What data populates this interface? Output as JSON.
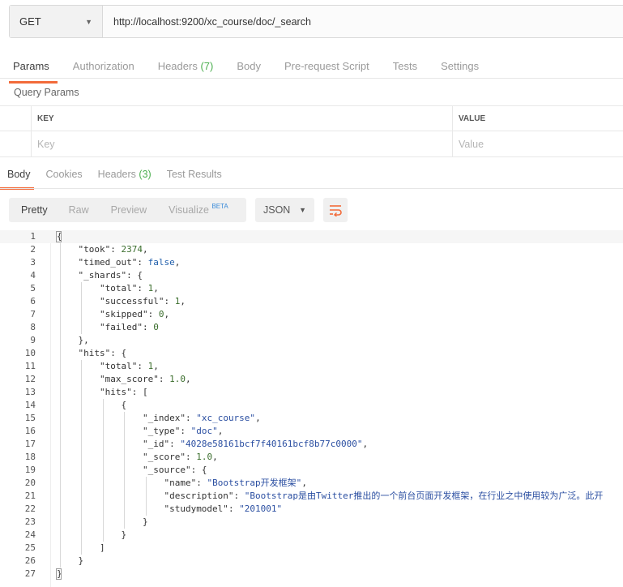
{
  "request": {
    "method": "GET",
    "url": "http://localhost:9200/xc_course/doc/_search"
  },
  "request_tabs": [
    {
      "label": "Params",
      "active": true
    },
    {
      "label": "Authorization"
    },
    {
      "label": "Headers",
      "count": "(7)"
    },
    {
      "label": "Body"
    },
    {
      "label": "Pre-request Script"
    },
    {
      "label": "Tests"
    },
    {
      "label": "Settings"
    }
  ],
  "query_params": {
    "title": "Query Params",
    "key_header": "KEY",
    "value_header": "VALUE",
    "key_placeholder": "Key",
    "value_placeholder": "Value"
  },
  "response_tabs": [
    {
      "label": "Body",
      "active": true
    },
    {
      "label": "Cookies"
    },
    {
      "label": "Headers",
      "count": "(3)"
    },
    {
      "label": "Test Results"
    }
  ],
  "view_modes": {
    "pretty": "Pretty",
    "raw": "Raw",
    "preview": "Preview",
    "visualize": "Visualize",
    "beta": "BETA"
  },
  "format": "JSON",
  "colors": {
    "accent": "#f26b3a",
    "count": "#4caf50",
    "string": "#2a4ea1",
    "number": "#3b6e2d",
    "bool": "#1f5eab"
  },
  "code_lines": [
    [
      [
        "p",
        "{"
      ]
    ],
    [
      [
        "p",
        "    "
      ],
      [
        "k",
        "\"took\""
      ],
      [
        "p",
        ": "
      ],
      [
        "n",
        "2374"
      ],
      [
        "p",
        ","
      ]
    ],
    [
      [
        "p",
        "    "
      ],
      [
        "k",
        "\"timed_out\""
      ],
      [
        "p",
        ": "
      ],
      [
        "b",
        "false"
      ],
      [
        "p",
        ","
      ]
    ],
    [
      [
        "p",
        "    "
      ],
      [
        "k",
        "\"_shards\""
      ],
      [
        "p",
        ": {"
      ]
    ],
    [
      [
        "p",
        "        "
      ],
      [
        "k",
        "\"total\""
      ],
      [
        "p",
        ": "
      ],
      [
        "n",
        "1"
      ],
      [
        "p",
        ","
      ]
    ],
    [
      [
        "p",
        "        "
      ],
      [
        "k",
        "\"successful\""
      ],
      [
        "p",
        ": "
      ],
      [
        "n",
        "1"
      ],
      [
        "p",
        ","
      ]
    ],
    [
      [
        "p",
        "        "
      ],
      [
        "k",
        "\"skipped\""
      ],
      [
        "p",
        ": "
      ],
      [
        "n",
        "0"
      ],
      [
        "p",
        ","
      ]
    ],
    [
      [
        "p",
        "        "
      ],
      [
        "k",
        "\"failed\""
      ],
      [
        "p",
        ": "
      ],
      [
        "n",
        "0"
      ]
    ],
    [
      [
        "p",
        "    },"
      ]
    ],
    [
      [
        "p",
        "    "
      ],
      [
        "k",
        "\"hits\""
      ],
      [
        "p",
        ": {"
      ]
    ],
    [
      [
        "p",
        "        "
      ],
      [
        "k",
        "\"total\""
      ],
      [
        "p",
        ": "
      ],
      [
        "n",
        "1"
      ],
      [
        "p",
        ","
      ]
    ],
    [
      [
        "p",
        "        "
      ],
      [
        "k",
        "\"max_score\""
      ],
      [
        "p",
        ": "
      ],
      [
        "n",
        "1.0"
      ],
      [
        "p",
        ","
      ]
    ],
    [
      [
        "p",
        "        "
      ],
      [
        "k",
        "\"hits\""
      ],
      [
        "p",
        ": ["
      ]
    ],
    [
      [
        "p",
        "            {"
      ]
    ],
    [
      [
        "p",
        "                "
      ],
      [
        "k",
        "\"_index\""
      ],
      [
        "p",
        ": "
      ],
      [
        "s",
        "\"xc_course\""
      ],
      [
        "p",
        ","
      ]
    ],
    [
      [
        "p",
        "                "
      ],
      [
        "k",
        "\"_type\""
      ],
      [
        "p",
        ": "
      ],
      [
        "s",
        "\"doc\""
      ],
      [
        "p",
        ","
      ]
    ],
    [
      [
        "p",
        "                "
      ],
      [
        "k",
        "\"_id\""
      ],
      [
        "p",
        ": "
      ],
      [
        "s",
        "\"4028e58161bcf7f40161bcf8b77c0000\""
      ],
      [
        "p",
        ","
      ]
    ],
    [
      [
        "p",
        "                "
      ],
      [
        "k",
        "\"_score\""
      ],
      [
        "p",
        ": "
      ],
      [
        "n",
        "1.0"
      ],
      [
        "p",
        ","
      ]
    ],
    [
      [
        "p",
        "                "
      ],
      [
        "k",
        "\"_source\""
      ],
      [
        "p",
        ": {"
      ]
    ],
    [
      [
        "p",
        "                    "
      ],
      [
        "k",
        "\"name\""
      ],
      [
        "p",
        ": "
      ],
      [
        "s",
        "\"Bootstrap开发框架\""
      ],
      [
        "p",
        ","
      ]
    ],
    [
      [
        "p",
        "                    "
      ],
      [
        "k",
        "\"description\""
      ],
      [
        "p",
        ": "
      ],
      [
        "s",
        "\"Bootstrap是由Twitter推出的一个前台页面开发框架，在行业之中使用较为广泛。此开"
      ]
    ],
    [
      [
        "p",
        "                    "
      ],
      [
        "k",
        "\"studymodel\""
      ],
      [
        "p",
        ": "
      ],
      [
        "s",
        "\"201001\""
      ]
    ],
    [
      [
        "p",
        "                }"
      ]
    ],
    [
      [
        "p",
        "            }"
      ]
    ],
    [
      [
        "p",
        "        ]"
      ]
    ],
    [
      [
        "p",
        "    }"
      ]
    ],
    [
      [
        "p",
        "}"
      ]
    ]
  ]
}
